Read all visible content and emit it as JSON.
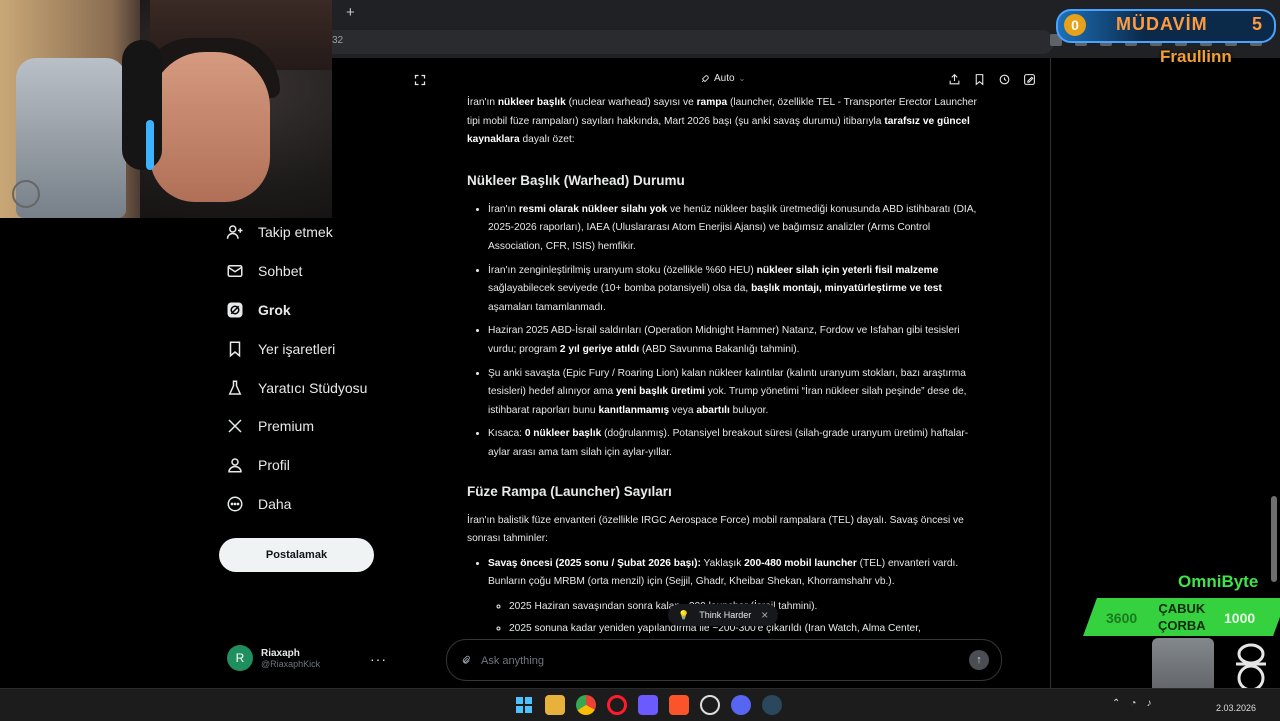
{
  "browser": {
    "new_tab_symbol": "+",
    "address_fragment": "32"
  },
  "nav": {
    "items": [
      {
        "label": "Takip etmek",
        "icon": "person-add-icon"
      },
      {
        "label": "Sohbet",
        "icon": "mail-icon"
      },
      {
        "label": "Grok",
        "icon": "grok-icon",
        "active": true
      },
      {
        "label": "Yer işaretleri",
        "icon": "bookmark-icon"
      },
      {
        "label": "Yaratıcı Stüdyosu",
        "icon": "flask-icon"
      },
      {
        "label": "Premium",
        "icon": "x-logo-icon"
      },
      {
        "label": "Profil",
        "icon": "person-icon"
      },
      {
        "label": "Daha",
        "icon": "more-circle-icon"
      }
    ],
    "post_button": "Postalamak",
    "account": {
      "initial": "R",
      "name": "Riaxaph",
      "handle": "@RiaxaphKick",
      "more": "···"
    }
  },
  "toolbar": {
    "mode": "Auto"
  },
  "article": {
    "intro": [
      {
        "t": "İran'ın "
      },
      {
        "b": "nükleer başlık"
      },
      {
        "t": " (nuclear warhead) sayısı ve "
      },
      {
        "b": "rampa"
      },
      {
        "t": " (launcher, özellikle TEL - Transporter Erector Launcher tipi mobil füze rampaları) sayıları hakkında, Mart 2026 başı (şu anki savaş durumu) itibarıyla "
      },
      {
        "b": "tarafsız ve güncel kaynaklara"
      },
      {
        "t": " dayalı özet:"
      }
    ],
    "h1": "Nükleer Başlık (Warhead) Durumu",
    "bullets1": [
      [
        {
          "t": "İran'ın "
        },
        {
          "b": "resmi olarak nükleer silahı yok"
        },
        {
          "t": " ve henüz nükleer başlık üretmediği konusunda ABD istihbaratı (DIA, 2025-2026 raporları), IAEA (Uluslararası Atom Enerjisi Ajansı) ve bağımsız analizler (Arms Control Association, CFR, ISIS) hemfikir."
        }
      ],
      [
        {
          "t": "İran'ın zenginleştirilmiş uranyum stoku (özellikle %60 HEU) "
        },
        {
          "b": "nükleer silah için yeterli fisil malzeme"
        },
        {
          "t": " sağlayabilecek seviyede (10+ bomba potansiyeli) olsa da, "
        },
        {
          "b": "başlık montajı, minyatürleştirme ve test"
        },
        {
          "t": " aşamaları tamamlanmadı."
        }
      ],
      [
        {
          "t": "Haziran 2025 ABD-İsrail saldırıları (Operation Midnight Hammer) Natanz, Fordow ve Isfahan gibi tesisleri vurdu; program "
        },
        {
          "b": "2 yıl geriye atıldı"
        },
        {
          "t": " (ABD Savunma Bakanlığı tahmini)."
        }
      ],
      [
        {
          "t": "Şu anki savaşta (Epic Fury / Roaring Lion) kalan nükleer kalıntılar (kalıntı uranyum stokları, bazı araştırma tesisleri) hedef alınıyor ama "
        },
        {
          "b": "yeni başlık üretimi"
        },
        {
          "t": " yok. Trump yönetimi “İran nükleer silah peşinde” dese de, istihbarat raporları bunu "
        },
        {
          "b": "kanıtlanmamış"
        },
        {
          "t": " veya "
        },
        {
          "b": "abartılı"
        },
        {
          "t": " buluyor."
        }
      ],
      [
        {
          "t": "Kısaca: "
        },
        {
          "b": "0 nükleer başlık"
        },
        {
          "t": " (doğrulanmış). Potansiyel breakout süresi (silah-grade uranyum üretimi) haftalar-aylar arası ama tam silah için aylar-yıllar."
        }
      ]
    ],
    "h2": "Füze Rampa (Launcher) Sayıları",
    "intro2": [
      {
        "t": "İran'ın balistik füze envanteri (özellikle IRGC Aerospace Force) mobil rampalara (TEL) dayalı. Savaş öncesi ve sonrası tahminler:"
      }
    ],
    "bullets2": [
      [
        {
          "b": "Savaş öncesi (2025 sonu / Şubat 2026 başı):"
        },
        {
          "t": " Yaklaşık "
        },
        {
          "b": "200-480 mobil launcher"
        },
        {
          "t": " (TEL) envanteri vardı. Bunların çoğu MRBM (orta menzil) için (Sejjil, Ghadr, Kheibar Shekan, Khorramshahr vb.)."
        }
      ]
    ],
    "sub_bullets": [
      [
        {
          "t": "2025 Haziran savaşından sonra kalan ~200 launcher (İsrail tahmini)."
        }
      ],
      [
        {
          "t": "2025 sonuna kadar yeniden yapılandırma ile ~200-300'e çıkarıldı (Iran Watch, Alma Center,"
        }
      ]
    ]
  },
  "think_chip": {
    "label": "Think Harder",
    "close": "×"
  },
  "composer": {
    "placeholder": "Ask anything",
    "send": "↑"
  },
  "overlays": {
    "mudavim": {
      "badge": "0",
      "label": "MÜDAVİM",
      "count": "5"
    },
    "fraulinn": "Fraullinn",
    "omnibyte": "OmniByte",
    "bar_left": "3600",
    "bar_mid_1": "ÇABUK",
    "bar_mid_2": "ÇORBA",
    "bar_right": "1000"
  },
  "taskbar": {
    "date": "2.03.2026"
  }
}
